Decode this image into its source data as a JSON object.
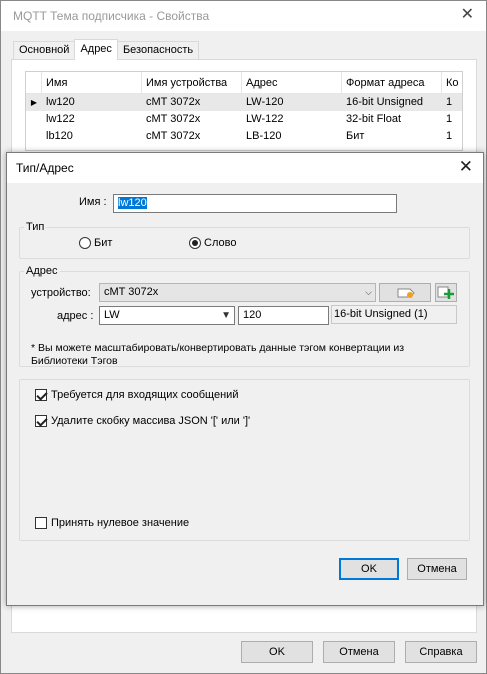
{
  "window": {
    "title": "MQTT Тема подписчика - Свойства",
    "close_glyph": "✕",
    "tabs": [
      {
        "label": "Основной",
        "active": false
      },
      {
        "label": "Адрес",
        "active": true
      },
      {
        "label": "Безопасность",
        "active": false
      }
    ],
    "table": {
      "columns": [
        "Имя",
        "Имя устройства",
        "Адрес",
        "Формат адреса",
        "Ко"
      ],
      "rows": [
        {
          "marker": "▶",
          "name": "lw120",
          "device": "cMT 3072x",
          "address": "LW-120",
          "format": "16-bit Unsigned",
          "count": "1"
        },
        {
          "marker": "",
          "name": "lw122",
          "device": "cMT 3072x",
          "address": "LW-122",
          "format": "32-bit Float",
          "count": "1"
        },
        {
          "marker": "",
          "name": "lb120",
          "device": "cMT 3072x",
          "address": "LB-120",
          "format": "Бит",
          "count": "1"
        }
      ]
    },
    "buttons": {
      "ok": "OK",
      "cancel": "Отмена",
      "help": "Справка"
    }
  },
  "dialog": {
    "title": "Тип/Адрес",
    "close_glyph": "✕",
    "name_label": "Имя :",
    "name_value": "lw120",
    "type_group": {
      "title": "Тип",
      "bit_label": "Бит",
      "word_label": "Слово",
      "selected": "word"
    },
    "address_group": {
      "title": "Адрес",
      "device_label": "устройство:",
      "device_value": "cMT 3072x",
      "address_label": "адрес :",
      "address_type": "LW",
      "address_value": "120",
      "format_readonly": "16-bit Unsigned (1)",
      "note": "* Вы можете масштабировать/конвертировать данные тэгом конвертации из Библиотеки Тэгов"
    },
    "options": {
      "incoming_label": "Требуется для входящих сообщений",
      "incoming_checked": true,
      "json_label": "Удалите скобку массива JSON '[' или ']'",
      "json_checked": true,
      "null_label": "Принять нулевое значение",
      "null_checked": false
    },
    "buttons": {
      "ok": "OK",
      "cancel": "Отмена"
    }
  }
}
